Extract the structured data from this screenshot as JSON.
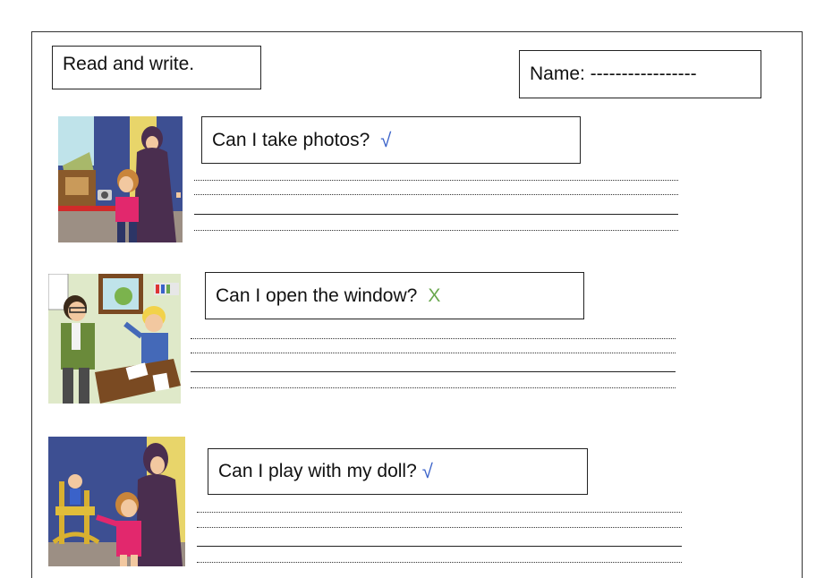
{
  "worksheet": {
    "instruction": "Read and write.",
    "name_label": "Name: -----------------"
  },
  "questions": [
    {
      "text": "Can I take photos?",
      "mark": "√"
    },
    {
      "text": "Can I open the window?",
      "mark": "X"
    },
    {
      "text": "Can I play with my doll?",
      "mark": "√"
    }
  ],
  "colors": {
    "tick": "#3a62c9",
    "cross": "#6aa84f"
  }
}
